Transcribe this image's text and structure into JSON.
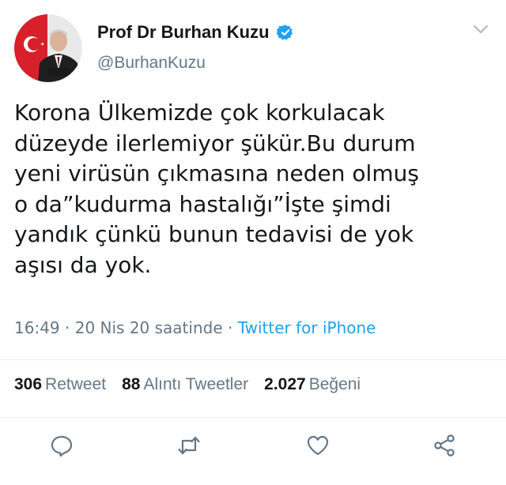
{
  "colors": {
    "link": "#1da1f2",
    "secondary": "#657786",
    "text": "#14171a",
    "divider": "#e6ecf0"
  },
  "profile": {
    "display_name": "Prof Dr Burhan Kuzu",
    "handle": "@BurhanKuzu",
    "verified_icon": "verified-badge-icon",
    "menu_icon": "chevron-down-icon"
  },
  "tweet": {
    "text": "Korona Ülkemizde çok korkulacak\ndüzeyde ilerlemiyor şükür.Bu durum\nyeni virüsün çıkmasına neden olmuş\no da”kudurma hastalığı”İşte şimdi\nyandık çünkü bunun tedavisi de yok\naşısı da yok.",
    "time": "16:49",
    "separator1": " · ",
    "date": "20 Nis 20 saatinde",
    "separator2": " · ",
    "source": "Twitter for iPhone"
  },
  "stats": {
    "retweets": {
      "count": "306",
      "label": "Retweet"
    },
    "quotes": {
      "count": "88",
      "label": "Alıntı Tweetler"
    },
    "likes": {
      "count": "2.027",
      "label": "Beğeni"
    }
  },
  "actions": [
    "reply-icon",
    "retweet-icon",
    "like-icon",
    "share-icon"
  ]
}
